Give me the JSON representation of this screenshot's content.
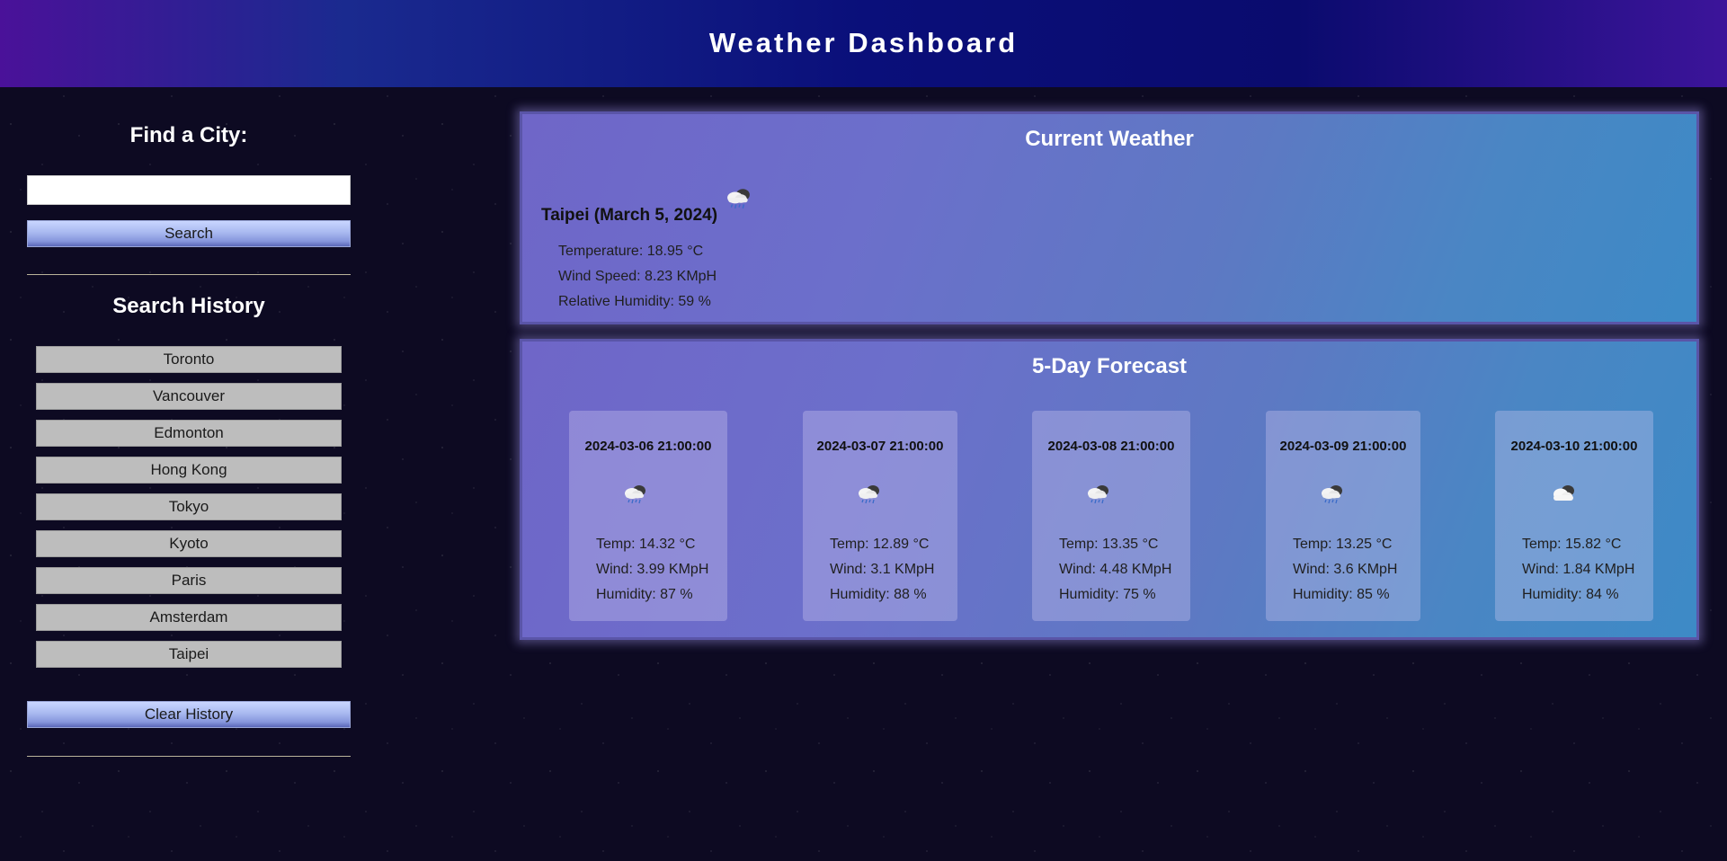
{
  "header": {
    "title": "Weather Dashboard"
  },
  "sidebar": {
    "find_title": "Find a City:",
    "search_input_value": "",
    "search_label": "Search",
    "history_title": "Search History",
    "history": [
      "Toronto",
      "Vancouver",
      "Edmonton",
      "Hong Kong",
      "Tokyo",
      "Kyoto",
      "Paris",
      "Amsterdam",
      "Taipei"
    ],
    "clear_label": "Clear History"
  },
  "current": {
    "title": "Current Weather",
    "city_date": "Taipei (March 5, 2024)",
    "icon": "rain-cloud-icon",
    "temperature": "Temperature: 18.95 °C",
    "wind": "Wind Speed: 8.23 KMpH",
    "humidity": "Relative Humidity: 59 %"
  },
  "forecast": {
    "title": "5-Day Forecast",
    "days": [
      {
        "date": "2024-03-06 21:00:00",
        "icon": "rain-cloud-icon",
        "temp": "Temp: 14.32 °C",
        "wind": "Wind: 3.99 KMpH",
        "humidity": "Humidity: 87 %"
      },
      {
        "date": "2024-03-07 21:00:00",
        "icon": "rain-cloud-icon",
        "temp": "Temp: 12.89 °C",
        "wind": "Wind: 3.1 KMpH",
        "humidity": "Humidity: 88 %"
      },
      {
        "date": "2024-03-08 21:00:00",
        "icon": "rain-cloud-icon",
        "temp": "Temp: 13.35 °C",
        "wind": "Wind: 4.48 KMpH",
        "humidity": "Humidity: 75 %"
      },
      {
        "date": "2024-03-09 21:00:00",
        "icon": "rain-cloud-icon",
        "temp": "Temp: 13.25 °C",
        "wind": "Wind: 3.6 KMpH",
        "humidity": "Humidity: 85 %"
      },
      {
        "date": "2024-03-10 21:00:00",
        "icon": "cloudy-icon",
        "temp": "Temp: 15.82 °C",
        "wind": "Wind: 1.84 KMpH",
        "humidity": "Humidity: 84 %"
      }
    ]
  }
}
